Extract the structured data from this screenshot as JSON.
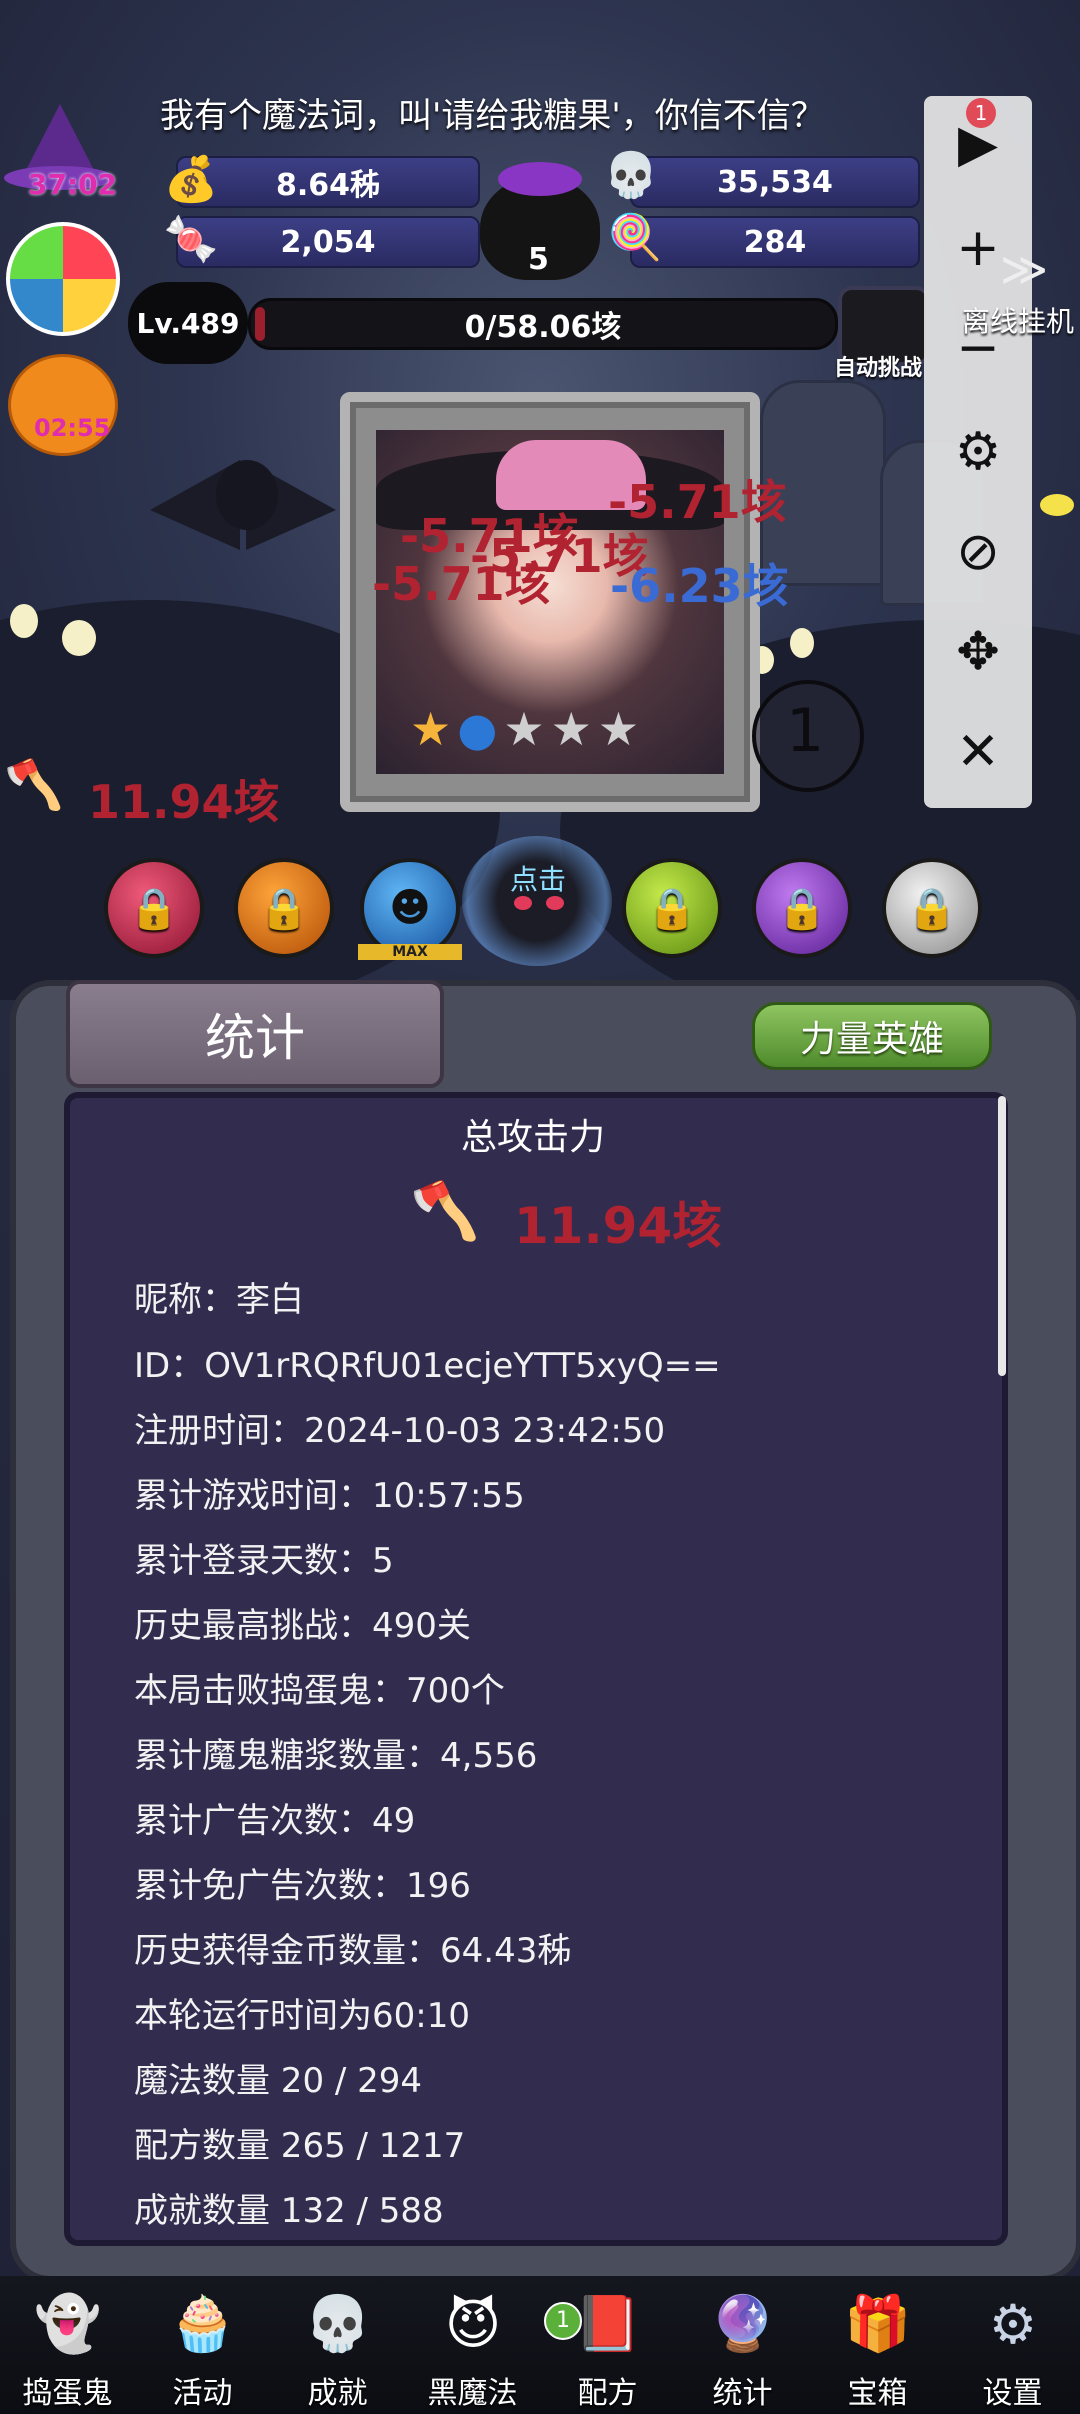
{
  "header": {
    "message": "我有个魔法词，叫'请给我糖果'，你信不信？",
    "timer": "37:02",
    "pumpkin_timer": "02:55"
  },
  "resources": {
    "coins": "8.64秭",
    "skulls": "35,534",
    "candies_red": "2,054",
    "cauldron_count": "5",
    "candy_corn": "284"
  },
  "level": {
    "label": "Lv.489",
    "progress_text": "0/58.06垓",
    "progress_fraction": 0.0,
    "auto_challenge": "自动挑战"
  },
  "toolbar": {
    "offline_label": "离线挂机",
    "badge": "1"
  },
  "battle": {
    "damage_texts": [
      "-5.71垓",
      "-5.71垓",
      "-5.71垓",
      "-5.71垓"
    ],
    "damage_blue": "-6.23垓",
    "total_attack": "11.94垓",
    "stage_number": "1",
    "tap_label": "点击",
    "max_label": "MAX"
  },
  "panel": {
    "tab_title": "统计",
    "hero_button": "力量英雄",
    "total_attack_title": "总攻击力",
    "total_attack_value": "11.94垓",
    "lines": [
      "昵称：李白",
      "ID：OV1rRQRfU01ecjeYTT5xyQ==",
      "注册时间：2024-10-03 23:42:50",
      "累计游戏时间：10:57:55",
      "累计登录天数：5",
      "历史最高挑战：490关",
      "本局击败捣蛋鬼：700个",
      "累计魔鬼糖浆数量：4,556",
      "累计广告次数：49",
      "累计免广告次数：196",
      "历史获得金币数量：64.43秭",
      "本轮运行时间为60:10",
      "魔法数量 20 / 294",
      "配方数量 265 / 1217",
      "成就数量 132 / 588"
    ]
  },
  "nav": {
    "items": [
      "捣蛋鬼",
      "活动",
      "成就",
      "黑魔法",
      "配方",
      "统计",
      "宝箱",
      "设置"
    ],
    "badge": "1"
  },
  "colors": {
    "damage_red": "#b22331",
    "damage_blue": "#3a6bd4",
    "hero_green": "#6aa83e"
  }
}
